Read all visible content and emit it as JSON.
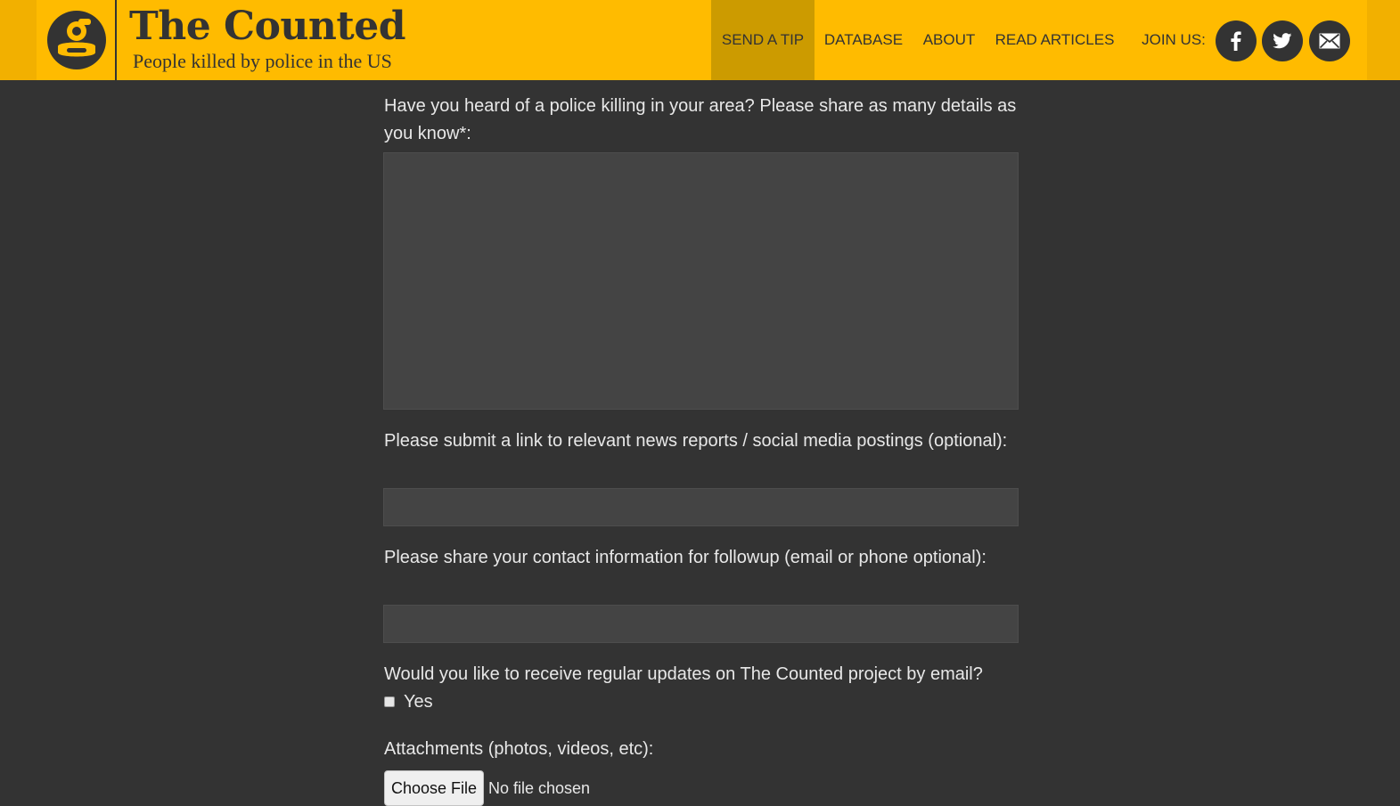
{
  "header": {
    "logo_icon": "guardian-g-icon",
    "title": "The Counted",
    "subtitle": "People killed by police in the US",
    "brand_color": "#ffbb00",
    "nav": [
      {
        "label": "SEND A TIP",
        "active": true
      },
      {
        "label": "DATABASE",
        "active": false
      },
      {
        "label": "ABOUT",
        "active": false
      },
      {
        "label": "READ ARTICLES",
        "active": false
      }
    ],
    "join_label": "JOIN US:",
    "social": [
      {
        "icon": "facebook-icon"
      },
      {
        "icon": "twitter-icon"
      },
      {
        "icon": "email-icon"
      }
    ]
  },
  "form": {
    "details_label": "Have you heard of a police killing in your area? Please share as many details as you know*:",
    "details_value": "",
    "link_label": "Please submit a link to relevant news reports / social media postings (optional):",
    "link_value": "",
    "contact_label": "Please share your contact information for followup (email or phone optional):",
    "contact_value": "",
    "updates_label": "Would you like to receive regular updates on The Counted project by email?",
    "updates_option": "Yes",
    "updates_checked": false,
    "attachments_label": "Attachments (photos, videos, etc):",
    "choose_file_label": "Choose File",
    "file_status": "No file chosen"
  }
}
